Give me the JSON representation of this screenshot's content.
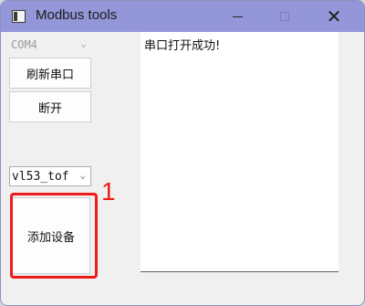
{
  "window": {
    "title": "Modbus tools",
    "icon": "app-window-icon",
    "controls": {
      "minimize_icon": "minimize-icon",
      "maximize_icon": "maximize-icon",
      "close_glyph": "✕"
    }
  },
  "serial": {
    "port_value": "COM4",
    "refresh_label": "刷新串口",
    "disconnect_label": "断开"
  },
  "device": {
    "selected": "vl53_tof",
    "add_label": "添加设备"
  },
  "log": {
    "lines": [
      "串口打开成功!"
    ]
  },
  "annotation": {
    "number": "1",
    "color": "#ee1b1b"
  },
  "colors": {
    "titlebar": "#9396d8",
    "window_bg": "#f0f0f0"
  }
}
